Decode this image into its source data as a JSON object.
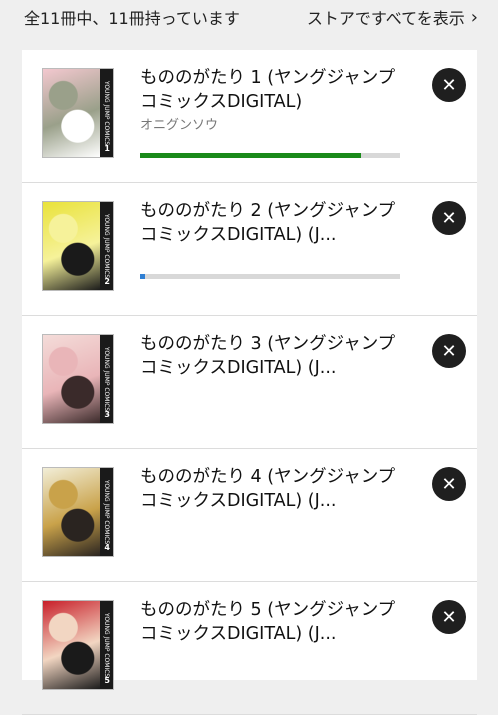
{
  "header": {
    "owned_count": "全11冊中、11冊持っています",
    "store_link": "ストアですべてを表示",
    "store_chevron": "›"
  },
  "colors": {
    "progress_green": "#1a8a1a",
    "progress_blue": "#2f7fd3"
  },
  "books": [
    {
      "title": "もののがたり 1 (ヤングジャンプコミックスDIGITAL)",
      "author": "オニグンソウ",
      "volume": "1",
      "progress": 0.85,
      "progress_color": "#1a8a1a",
      "cover_palette": [
        "#f3c8cf",
        "#ffffff",
        "#9aa08a"
      ]
    },
    {
      "title": "もののがたり 2 (ヤングジャンプコミックスDIGITAL) (J...",
      "volume": "2",
      "progress": 0.02,
      "progress_color": "#2f7fd3",
      "cover_palette": [
        "#e9e23a",
        "#1a1a1a",
        "#f6f29a"
      ]
    },
    {
      "title": "もののがたり 3 (ヤングジャンプコミックスDIGITAL) (J...",
      "volume": "3",
      "cover_palette": [
        "#f4dcd9",
        "#3a2a2a",
        "#e9b5b8"
      ]
    },
    {
      "title": "もののがたり 4 (ヤングジャンプコミックスDIGITAL) (J...",
      "volume": "4",
      "cover_palette": [
        "#f2eed8",
        "#2a2420",
        "#c9a24a"
      ]
    },
    {
      "title": "もののがたり 5 (ヤングジャンプコミックスDIGITAL) (J...",
      "volume": "5",
      "cover_palette": [
        "#c81f2a",
        "#1a1a1a",
        "#f2d6c2"
      ]
    }
  ],
  "spine_text": "YOUNG JUMP COMICS",
  "remove_symbol": "✕"
}
